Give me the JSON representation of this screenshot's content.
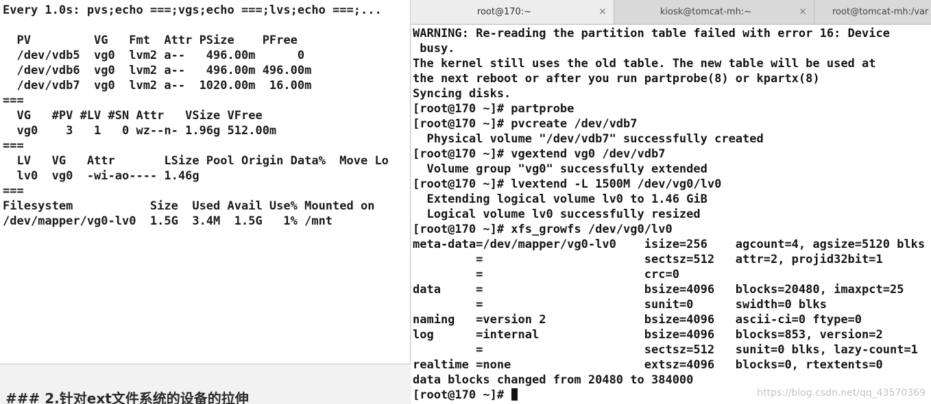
{
  "watch_terminal": {
    "lines": [
      "Every 1.0s: pvs;echo ===;vgs;echo ===;lvs;echo ===;...",
      "",
      "  PV         VG   Fmt  Attr PSize    PFree",
      "  /dev/vdb5  vg0  lvm2 a--   496.00m      0",
      "  /dev/vdb6  vg0  lvm2 a--   496.00m 496.00m",
      "  /dev/vdb7  vg0  lvm2 a--  1020.00m  16.00m",
      "===",
      "  VG   #PV #LV #SN Attr   VSize VFree",
      "  vg0    3   1   0 wz--n- 1.96g 512.00m",
      "===",
      "  LV   VG   Attr       LSize Pool Origin Data%  Move Lo",
      "  lv0  vg0  -wi-ao---- 1.46g",
      "===",
      "Filesystem           Size  Used Avail Use% Mounted on",
      "/dev/mapper/vg0-lv0  1.5G  3.4M  1.5G   1% /mnt"
    ]
  },
  "background_text": "### 2.针对ext文件系统的设备的拉伸",
  "tabs": [
    {
      "label": "root@170:~",
      "close": "×",
      "active": true
    },
    {
      "label": "kiosk@tomcat-mh:~",
      "close": "×",
      "active": false
    },
    {
      "label": "root@tomcat-mh:/var",
      "close": "",
      "active": false
    }
  ],
  "terminal": {
    "lines": [
      "WARNING: Re-reading the partition table failed with error 16: Device",
      " busy.",
      "The kernel still uses the old table. The new table will be used at",
      "the next reboot or after you run partprobe(8) or kpartx(8)",
      "Syncing disks.",
      "[root@170 ~]# partprobe",
      "[root@170 ~]# pvcreate /dev/vdb7",
      "  Physical volume \"/dev/vdb7\" successfully created",
      "[root@170 ~]# vgextend vg0 /dev/vdb7",
      "  Volume group \"vg0\" successfully extended",
      "[root@170 ~]# lvextend -L 1500M /dev/vg0/lv0",
      "  Extending logical volume lv0 to 1.46 GiB",
      "  Logical volume lv0 successfully resized",
      "[root@170 ~]# xfs_growfs /dev/vg0/lv0",
      "meta-data=/dev/mapper/vg0-lv0    isize=256    agcount=4, agsize=5120 blks",
      "         =                       sectsz=512   attr=2, projid32bit=1",
      "         =                       crc=0",
      "data     =                       bsize=4096   blocks=20480, imaxpct=25",
      "         =                       sunit=0      swidth=0 blks",
      "naming   =version 2              bsize=4096   ascii-ci=0 ftype=0",
      "log      =internal               bsize=4096   blocks=853, version=2",
      "         =                       sectsz=512   sunit=0 blks, lazy-count=1",
      "realtime =none                   extsz=4096   blocks=0, rtextents=0",
      "data blocks changed from 20480 to 384000"
    ],
    "prompt": "[root@170 ~]# "
  },
  "watermark": "https://blog.csdn.net/qq_43570369"
}
